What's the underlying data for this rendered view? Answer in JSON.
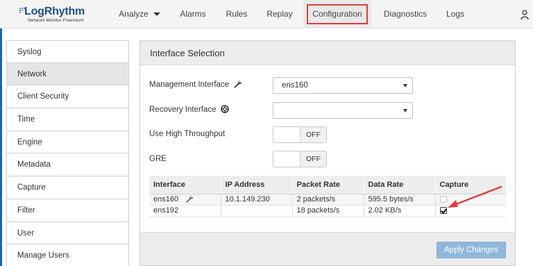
{
  "brand": {
    "name": "LogRhythm",
    "subtitle": "Network Monitor Freemium",
    "accent": "#1b66b1",
    "highlight": "#d9403a"
  },
  "nav": {
    "items": [
      {
        "label": "Analyze",
        "has_dropdown": true
      },
      {
        "label": "Alarms"
      },
      {
        "label": "Rules"
      },
      {
        "label": "Replay"
      },
      {
        "label": "Configuration",
        "active": true
      },
      {
        "label": "Diagnostics"
      },
      {
        "label": "Logs"
      }
    ],
    "user_icon": "user-settings-icon"
  },
  "sidebar": {
    "items": [
      {
        "label": "Syslog"
      },
      {
        "label": "Network",
        "active": true
      },
      {
        "label": "Client Security"
      },
      {
        "label": "Time"
      },
      {
        "label": "Engine"
      },
      {
        "label": "Metadata"
      },
      {
        "label": "Capture"
      },
      {
        "label": "Filter"
      },
      {
        "label": "User"
      },
      {
        "label": "Manage Users"
      }
    ]
  },
  "panel": {
    "title": "Interface Selection",
    "management": {
      "label": "Management Interface",
      "icon": "wrench-icon",
      "value": "ens160"
    },
    "recovery": {
      "label": "Recovery Interface",
      "icon": "lifebuoy-icon",
      "value": ""
    },
    "high_throughput": {
      "label": "Use High Throughput",
      "state": "OFF"
    },
    "gre": {
      "label": "GRE",
      "state": "OFF"
    },
    "table": {
      "headers": [
        "Interface",
        "IP Address",
        "Packet Rate",
        "Data Rate",
        "Capture"
      ],
      "rows": [
        {
          "interface": "ens160",
          "management": true,
          "ip": "10.1.149.230",
          "packet_rate": "2 packets/s",
          "data_rate": "595.5 bytes/s",
          "capture": false,
          "capture_enabled": false
        },
        {
          "interface": "ens192",
          "management": false,
          "ip": "",
          "packet_rate": "18 packets/s",
          "data_rate": "2.02 KB/s",
          "capture": true,
          "capture_enabled": true
        }
      ]
    },
    "apply_label": "Apply Changes"
  }
}
